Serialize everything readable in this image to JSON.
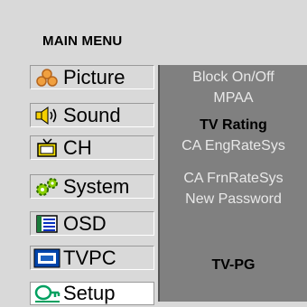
{
  "menu": {
    "title": "MAIN MENU",
    "items": [
      {
        "label": "Picture",
        "icon": "picture-icon"
      },
      {
        "label": "Sound",
        "icon": "speaker-icon"
      },
      {
        "label": "CH",
        "icon": "tv-icon"
      },
      {
        "label": "System",
        "icon": "gears-icon"
      },
      {
        "label": "OSD",
        "icon": "osd-icon"
      },
      {
        "label": "TVPC",
        "icon": "monitor-icon"
      },
      {
        "label": "Setup",
        "icon": "setup-icon"
      }
    ],
    "active_item": "Setup"
  },
  "submenu": {
    "options": [
      {
        "label": "Block On/Off"
      },
      {
        "label": "MPAA"
      },
      {
        "label": "TV Rating"
      },
      {
        "label": "CA EngRateSys"
      },
      {
        "label": "CA FrnRateSys"
      },
      {
        "label": "New Password"
      }
    ],
    "selected_option": "TV Rating",
    "current_value": "TV-PG"
  },
  "colors": {
    "background": "#d9d9d9",
    "panel": "#808080",
    "option_text": "#e8e8e8",
    "selected_text": "#000000"
  }
}
